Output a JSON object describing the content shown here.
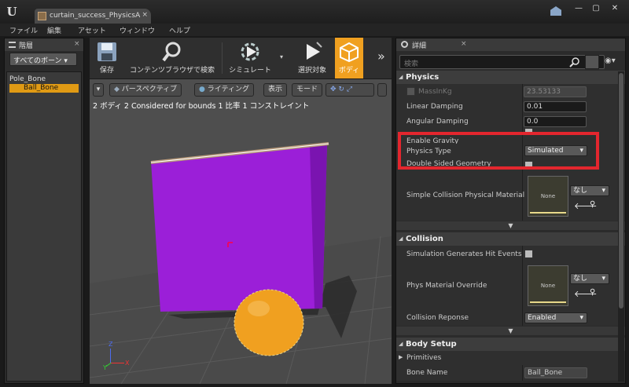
{
  "titlebar": {
    "logo": "U",
    "tab_title": "curtain_success_PhysicsA",
    "tab_close": "×",
    "btn_min": "—",
    "btn_max": "▢",
    "btn_close": "✕"
  },
  "menu": [
    "ファイル",
    "編集",
    "アセット",
    "ウィンドウ",
    "ヘルプ"
  ],
  "hierarchy": {
    "title": "階層",
    "close": "×",
    "filter": "すべてのボーン",
    "root": "Pole_Bone",
    "child": "Ball_Bone"
  },
  "toolbar": {
    "save": "保存",
    "browse": "コンテンツブラウザで検索",
    "simulate": "シミュレート",
    "selected": "選択対象",
    "body": "ボディ"
  },
  "viewport": {
    "perspective": "パースペクティブ",
    "lighting": "ライティング",
    "show": "表示",
    "mode": "モード",
    "info": "2 ボディ 2 Considered for bounds 1 比率 1 コンストレイント",
    "axis_x": "X",
    "axis_y": "Y",
    "axis_z": "Z"
  },
  "details": {
    "title": "詳細",
    "close": "×",
    "search_placeholder": "検索",
    "physics": {
      "heading": "Physics",
      "mass_label": "MassInKg",
      "mass_value": "23.53133",
      "linear_label": "Linear Damping",
      "linear_value": "0.01",
      "angular_label": "Angular Damping",
      "angular_value": "0.0",
      "gravity_label": "Enable Gravity",
      "type_label": "Physics Type",
      "type_value": "Simulated",
      "double_label": "Double Sided Geometry",
      "scpm_label": "Simple Collision Physical Material",
      "scpm_thumb": "None",
      "scpm_value": "なし"
    },
    "collision": {
      "heading": "Collision",
      "hit_label": "Simulation Generates Hit Events",
      "override_label": "Phys Material Override",
      "override_thumb": "None",
      "override_value": "なし",
      "response_label": "Collision Reponse",
      "response_value": "Enabled"
    },
    "body": {
      "heading": "Body Setup",
      "primitives": "Primitives",
      "bone_label": "Bone Name",
      "bone_value": "Ball_Bone"
    }
  },
  "colors": {
    "accent": "#f0a020",
    "highlight": "#e3262e",
    "curtain": "#9b1fd8",
    "ball": "#f0a020"
  }
}
